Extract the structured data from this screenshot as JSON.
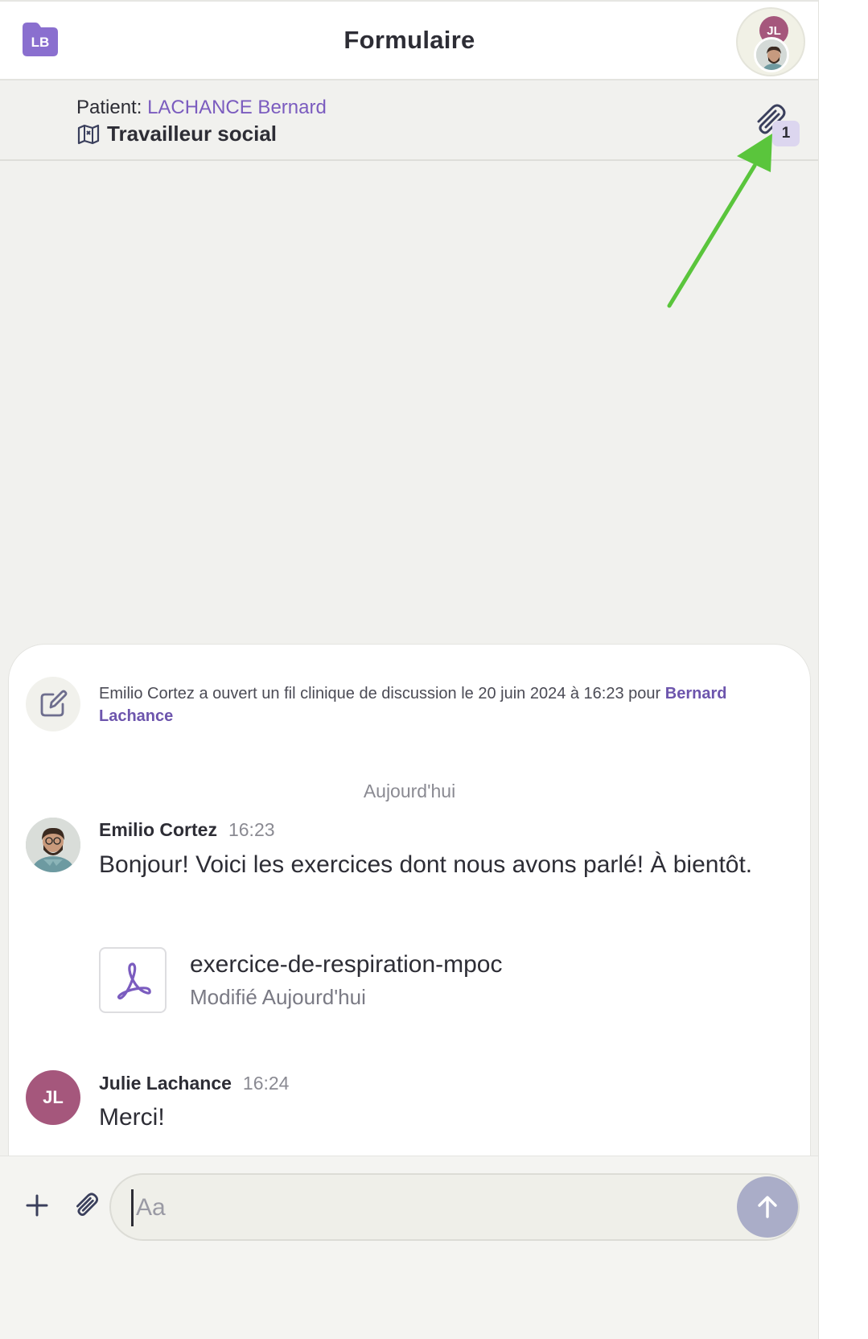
{
  "header": {
    "title": "Formulaire",
    "close_icon": "close-icon",
    "participants_initials": "JL"
  },
  "patient": {
    "label": "Patient:",
    "name": "LACHANCE Bernard",
    "initials": "LB",
    "role": "Travailleur social",
    "attachments_count": "1"
  },
  "system_message": {
    "text": "Emilio Cortez a ouvert un fil clinique de discussion le 20 juin 2024 à 16:23 pour ",
    "link": "Bernard Lachance"
  },
  "date_separator": "Aujourd'hui",
  "messages": [
    {
      "author": "Emilio Cortez",
      "time": "16:23",
      "body": "Bonjour! Voici les exercices dont nous avons parlé! À bientôt.",
      "attachment": {
        "name": "exercice-de-respiration-mpoc",
        "meta": "Modifié Aujourd'hui"
      }
    },
    {
      "author": "Julie Lachance",
      "initials": "JL",
      "time": "16:24",
      "body": "Merci!"
    }
  ],
  "composer": {
    "placeholder": "Aa"
  },
  "colors": {
    "accent_purple": "#7b5cbf",
    "avatar_jl": "#a5577c",
    "annotation_arrow": "#5ac53c",
    "send_button": "#aaadc8"
  }
}
